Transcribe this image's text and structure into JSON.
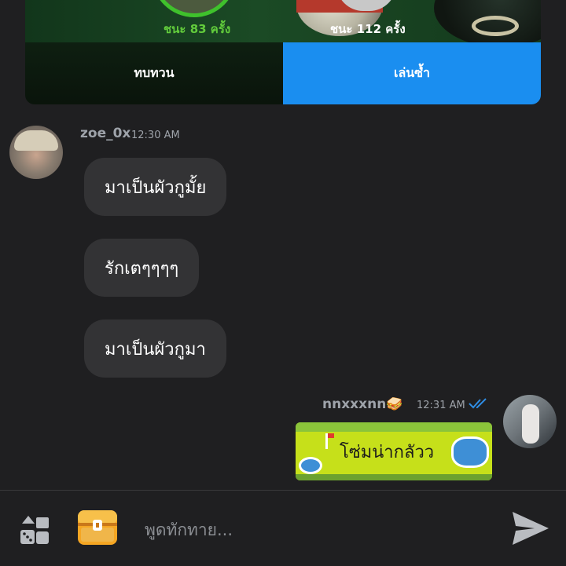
{
  "game": {
    "my_score": "ชนะ 83 ครั้ง",
    "opponent_score": "ชนะ 112 ครั้ง",
    "review_label": "ทบทวน",
    "rematch_label": "เล่นซ้ำ"
  },
  "messages": {
    "incoming": {
      "sender": "zoe_0x",
      "time": "12:30 AM",
      "bubbles": [
        "มาเป็นผัวกูมั้ย",
        "รักเตๆๆๆๆ",
        "มาเป็นผัวกูมา"
      ]
    },
    "outgoing": {
      "sender": "nnxxxnn",
      "sender_emoji": "🥪",
      "time": "12:31 AM",
      "status_icon": "double-check-icon",
      "sticker_text": "โซ่มน่ากลัวว"
    }
  },
  "composer": {
    "placeholder": "พูดทักทาย..."
  },
  "colors": {
    "accent": "#1a8ef0",
    "win_green": "#62cc3c",
    "bubble": "#333335",
    "background": "#1f1f21"
  },
  "icons": [
    "dice-games-icon",
    "treasure-chest-icon",
    "send-icon"
  ]
}
